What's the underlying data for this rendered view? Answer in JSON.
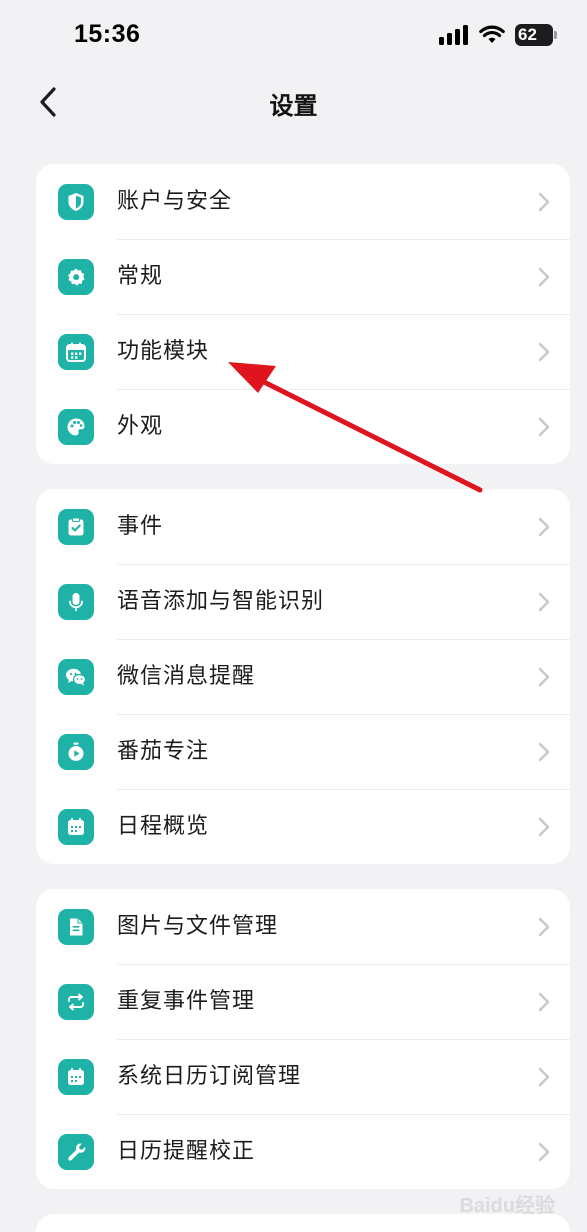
{
  "status_bar": {
    "time": "15:36",
    "battery": "62",
    "icons": [
      "cellular-signal-icon",
      "wifi-icon",
      "battery-icon"
    ]
  },
  "nav": {
    "back_icon": "chevron-left-icon",
    "title": "设置"
  },
  "accent_color": "#1eb3a6",
  "annotation_color": "#e0141e",
  "groups": [
    {
      "items": [
        {
          "label": "账户与安全",
          "icon": "shield-icon"
        },
        {
          "label": "常规",
          "icon": "gear-icon"
        },
        {
          "label": "功能模块",
          "icon": "calendar-icon"
        },
        {
          "label": "外观",
          "icon": "palette-icon"
        }
      ]
    },
    {
      "items": [
        {
          "label": "事件",
          "icon": "clipboard-check-icon"
        },
        {
          "label": "语音添加与智能识别",
          "icon": "microphone-icon"
        },
        {
          "label": "微信消息提醒",
          "icon": "wechat-icon"
        },
        {
          "label": "番茄专注",
          "icon": "timer-play-icon"
        },
        {
          "label": "日程概览",
          "icon": "calendar-grid-icon"
        }
      ]
    },
    {
      "items": [
        {
          "label": "图片与文件管理",
          "icon": "file-icon"
        },
        {
          "label": "重复事件管理",
          "icon": "repeat-icon"
        },
        {
          "label": "系统日历订阅管理",
          "icon": "calendar-grid-icon"
        },
        {
          "label": "日历提醒校正",
          "icon": "wrench-icon"
        }
      ]
    }
  ],
  "watermark": "Baidu经验"
}
